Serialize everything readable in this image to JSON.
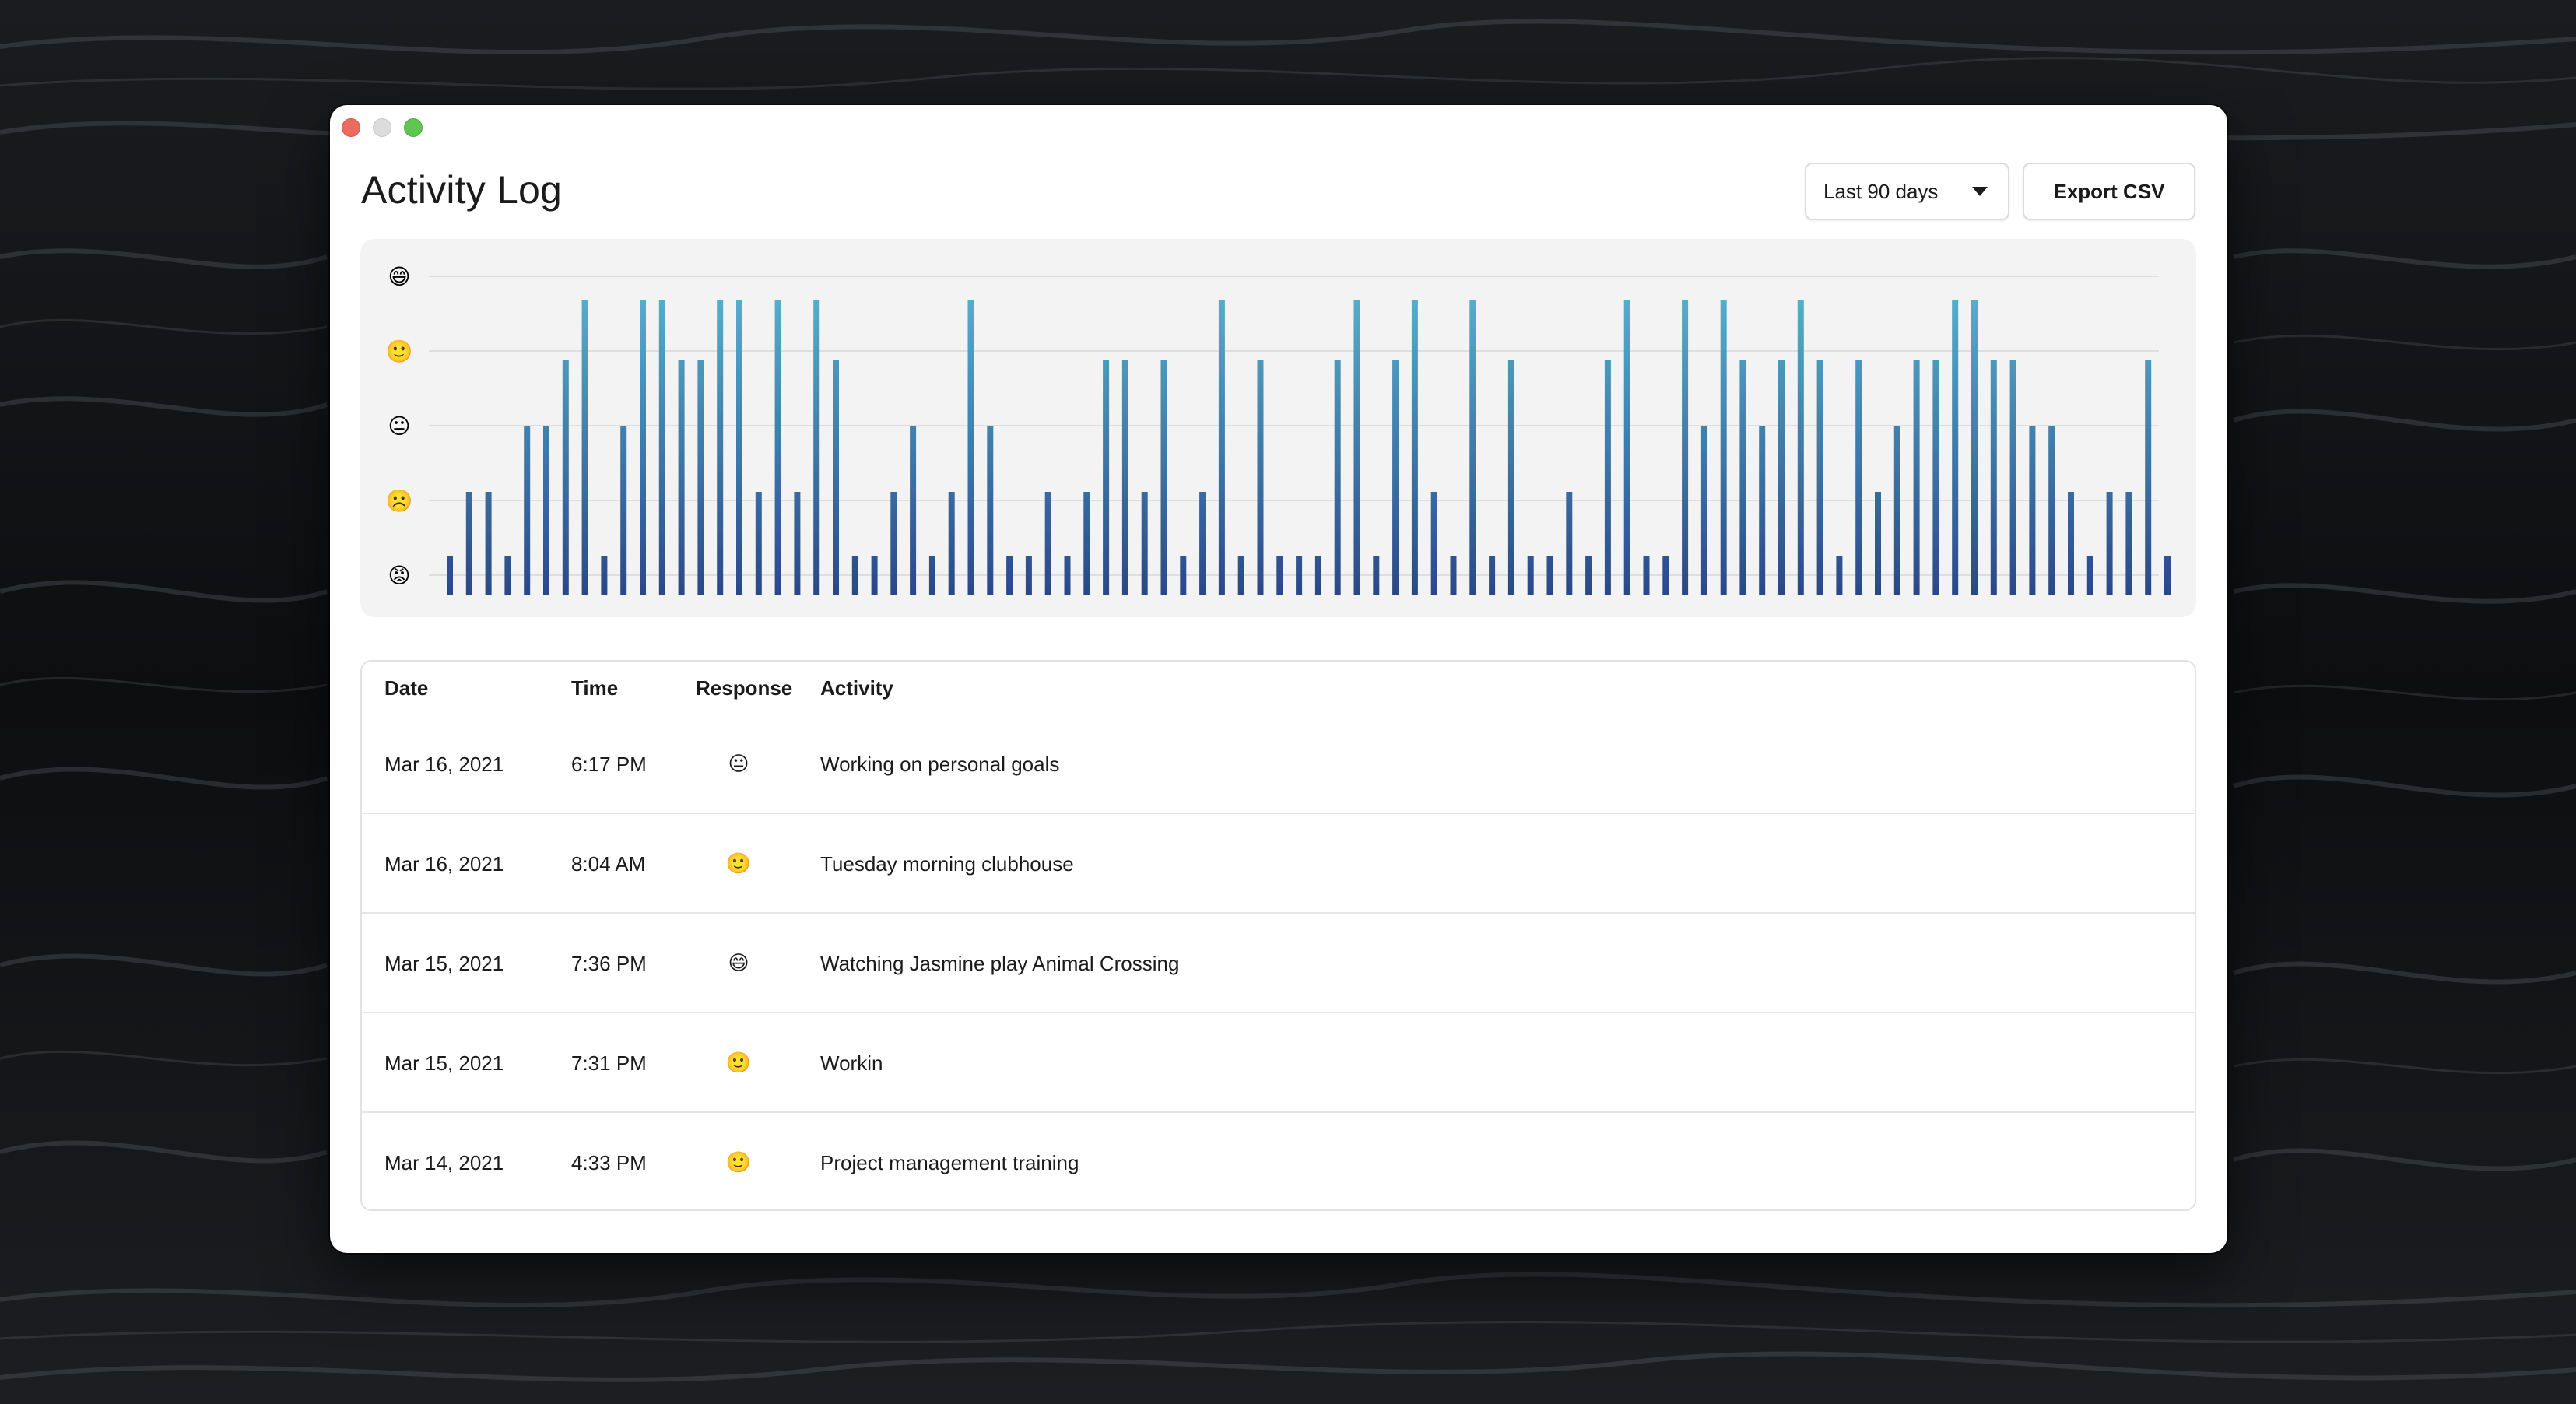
{
  "window": {
    "title": "Activity Log"
  },
  "controls": {
    "range_label": "Last 90 days",
    "export_label": "Export CSV"
  },
  "emoji": {
    "ecstatic": "😄",
    "happy": "🙂",
    "neutral": "😐",
    "sad": "☹️",
    "angry": "😡"
  },
  "chart_data": {
    "type": "bar",
    "x_label": "",
    "y_label": "",
    "levels": [
      {
        "value": 5,
        "label": "😄"
      },
      {
        "value": 4,
        "label": "🙂"
      },
      {
        "value": 3,
        "label": "😐"
      },
      {
        "value": 2,
        "label": "☹️"
      },
      {
        "value": 1,
        "label": "😡"
      }
    ],
    "ylim": [
      0.5,
      5
    ],
    "values": [
      1,
      2,
      2,
      1,
      3,
      3,
      4,
      5,
      1,
      3,
      5,
      5,
      4,
      4,
      5,
      5,
      2,
      5,
      2,
      5,
      4,
      1,
      1,
      2,
      3,
      1,
      2,
      5,
      3,
      1,
      1,
      2,
      1,
      2,
      4,
      4,
      2,
      4,
      1,
      2,
      5,
      1,
      4,
      1,
      1,
      1,
      4,
      5,
      1,
      4,
      5,
      2,
      1,
      5,
      1,
      4,
      1,
      1,
      2,
      1,
      4,
      5,
      1,
      1,
      5,
      3,
      5,
      4,
      3,
      4,
      5,
      4,
      1,
      4,
      2,
      3,
      4,
      4,
      5,
      5,
      4,
      4,
      3,
      3,
      2,
      1,
      2,
      2,
      4,
      1
    ],
    "grid": true,
    "colors": {
      "top": "#58b6cf",
      "bottom": "#2a4788",
      "grid": "#dedede",
      "background": "#f3f3f3"
    }
  },
  "table": {
    "headers": {
      "date": "Date",
      "time": "Time",
      "response": "Response",
      "activity": "Activity"
    },
    "rows": [
      {
        "date": "Mar 16, 2021",
        "time": "6:17 PM",
        "response": "😐",
        "activity": "Working on personal goals"
      },
      {
        "date": "Mar 16, 2021",
        "time": "8:04 AM",
        "response": "🙂",
        "activity": "Tuesday morning clubhouse"
      },
      {
        "date": "Mar 15, 2021",
        "time": "7:36 PM",
        "response": "😄",
        "activity": "Watching Jasmine play Animal Crossing"
      },
      {
        "date": "Mar 15, 2021",
        "time": "7:31 PM",
        "response": "🙂",
        "activity": "Workin"
      },
      {
        "date": "Mar 14, 2021",
        "time": "4:33 PM",
        "response": "🙂",
        "activity": "Project management training"
      }
    ]
  }
}
